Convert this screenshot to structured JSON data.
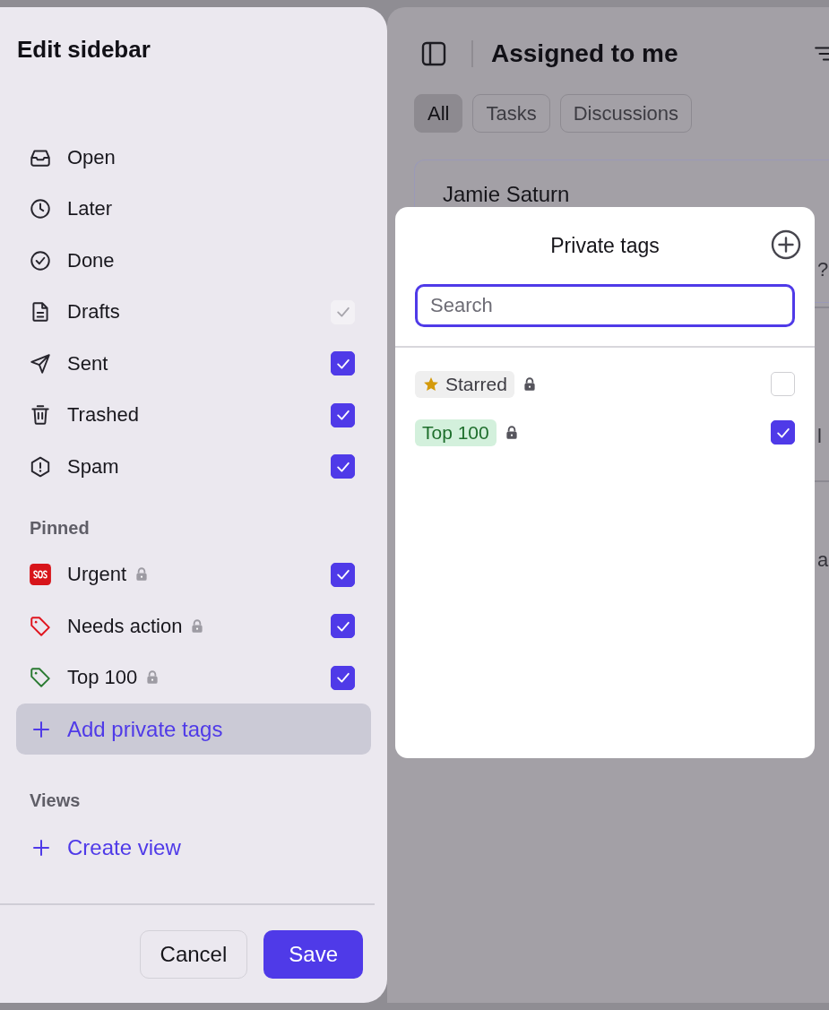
{
  "sidebar": {
    "title": "Edit sidebar",
    "items": [
      {
        "kind": "inbox",
        "label": "Open"
      },
      {
        "kind": "clock",
        "label": "Later"
      },
      {
        "kind": "done",
        "label": "Done"
      },
      {
        "kind": "draft",
        "label": "Drafts",
        "checked": true,
        "disabled": true
      },
      {
        "kind": "sent",
        "label": "Sent",
        "checked": true,
        "disabled": false
      },
      {
        "kind": "trash",
        "label": "Trashed",
        "checked": true,
        "disabled": false
      },
      {
        "kind": "spam",
        "label": "Spam",
        "checked": true,
        "disabled": false
      }
    ],
    "pinned": {
      "heading": "Pinned",
      "items": [
        {
          "kind": "sos",
          "label": "Urgent",
          "locked": true,
          "checked": true
        },
        {
          "kind": "tag",
          "color": "#e0141e",
          "label": "Needs action",
          "locked": true,
          "checked": true
        },
        {
          "kind": "tag",
          "color": "#2a7a32",
          "label": "Top 100",
          "locked": true,
          "checked": true
        }
      ],
      "add_button": "Add private tags"
    },
    "views": {
      "heading": "Views",
      "create_button": "Create view"
    },
    "buttons": [
      {
        "label": "Cancel",
        "kind": "secondary"
      },
      {
        "label": "Save",
        "kind": "primary"
      }
    ]
  },
  "main": {
    "title": "Assigned to me",
    "tabs": [
      {
        "label": "All",
        "selected": true
      },
      {
        "label": "Tasks",
        "selected": false
      },
      {
        "label": "Discussions",
        "selected": false
      }
    ],
    "card": {
      "name": "Jamie Saturn"
    },
    "edge_fragments": [
      "?",
      "l",
      "a"
    ]
  },
  "popup": {
    "title": "Private tags",
    "search": {
      "placeholder": "Search"
    },
    "tags": [
      {
        "label": "Starred",
        "kind": "star",
        "color": "#3c3b42",
        "locked": true,
        "checked": false
      },
      {
        "label": "Top 100",
        "kind": "plain",
        "color": "#1e6e2c",
        "locked": true,
        "checked": true
      }
    ]
  }
}
